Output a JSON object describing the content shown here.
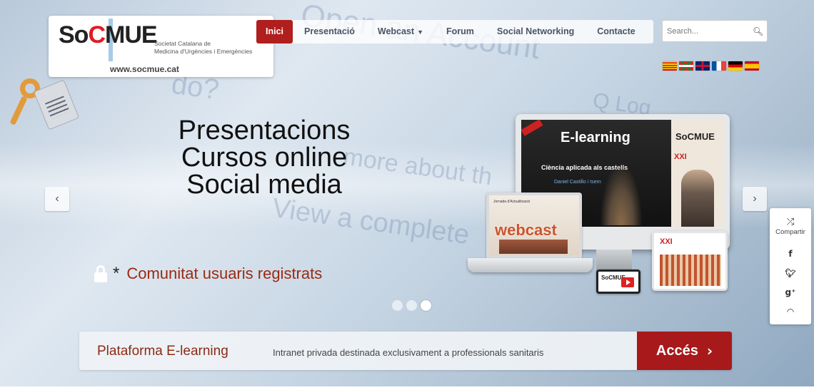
{
  "logo": {
    "wordmark_left": "So",
    "wordmark_mid": "C",
    "wordmark_right": "MUE",
    "org_line1": "Societat Catalana de",
    "org_line2": "Medicina d'Urgències i Emergències",
    "url": "www.socmue.cat"
  },
  "nav": {
    "items": [
      {
        "label": "Inici",
        "active": true
      },
      {
        "label": "Presentació"
      },
      {
        "label": "Webcast",
        "has_dropdown": true
      },
      {
        "label": "Forum"
      },
      {
        "label": "Social Networking"
      },
      {
        "label": "Contacte"
      }
    ],
    "chevron": "˅"
  },
  "search": {
    "placeholder": "Search...",
    "icon": "search-icon"
  },
  "flags": [
    "ca",
    "eu",
    "gb",
    "fr",
    "de",
    "es"
  ],
  "hero": {
    "line1": "Presentacions",
    "line2": "Cursos online",
    "line3": "Social media"
  },
  "carousel": {
    "prev": "‹",
    "next": "›",
    "slides": 3,
    "active_slide": 3
  },
  "registered": {
    "asterisk": "*",
    "label": "Comunitat usuaris registrats"
  },
  "devices": {
    "monitor_title": "E-learning",
    "monitor_subtitle": "Ciència aplicada als castells",
    "monitor_author": "Daniel Castillo i Isern",
    "mini_logo": "SoCMUE",
    "congress": "XXI",
    "laptop_heading": "Jornada d'Actualització",
    "laptop_word": "webcast",
    "tablet_congress": "XXI",
    "phone_logo": "SoCMUE"
  },
  "bottom": {
    "title": "Plataforma E-learning",
    "description": "Intranet privada destinada exclusivament a professionals sanitaris",
    "button_label": "Accés",
    "button_chevron": "›"
  },
  "share": {
    "label": "Compartir",
    "icons": [
      "facebook-icon",
      "twitter-icon",
      "google-plus-icon",
      "rss-icon"
    ],
    "glyphs": {
      "facebook": "f",
      "twitter": "🐦",
      "google": "g⁺",
      "rss": "〜"
    }
  },
  "colors": {
    "accent": "#b01e1e",
    "brand_red": "#e31b23",
    "text_red": "#9b2a10"
  }
}
